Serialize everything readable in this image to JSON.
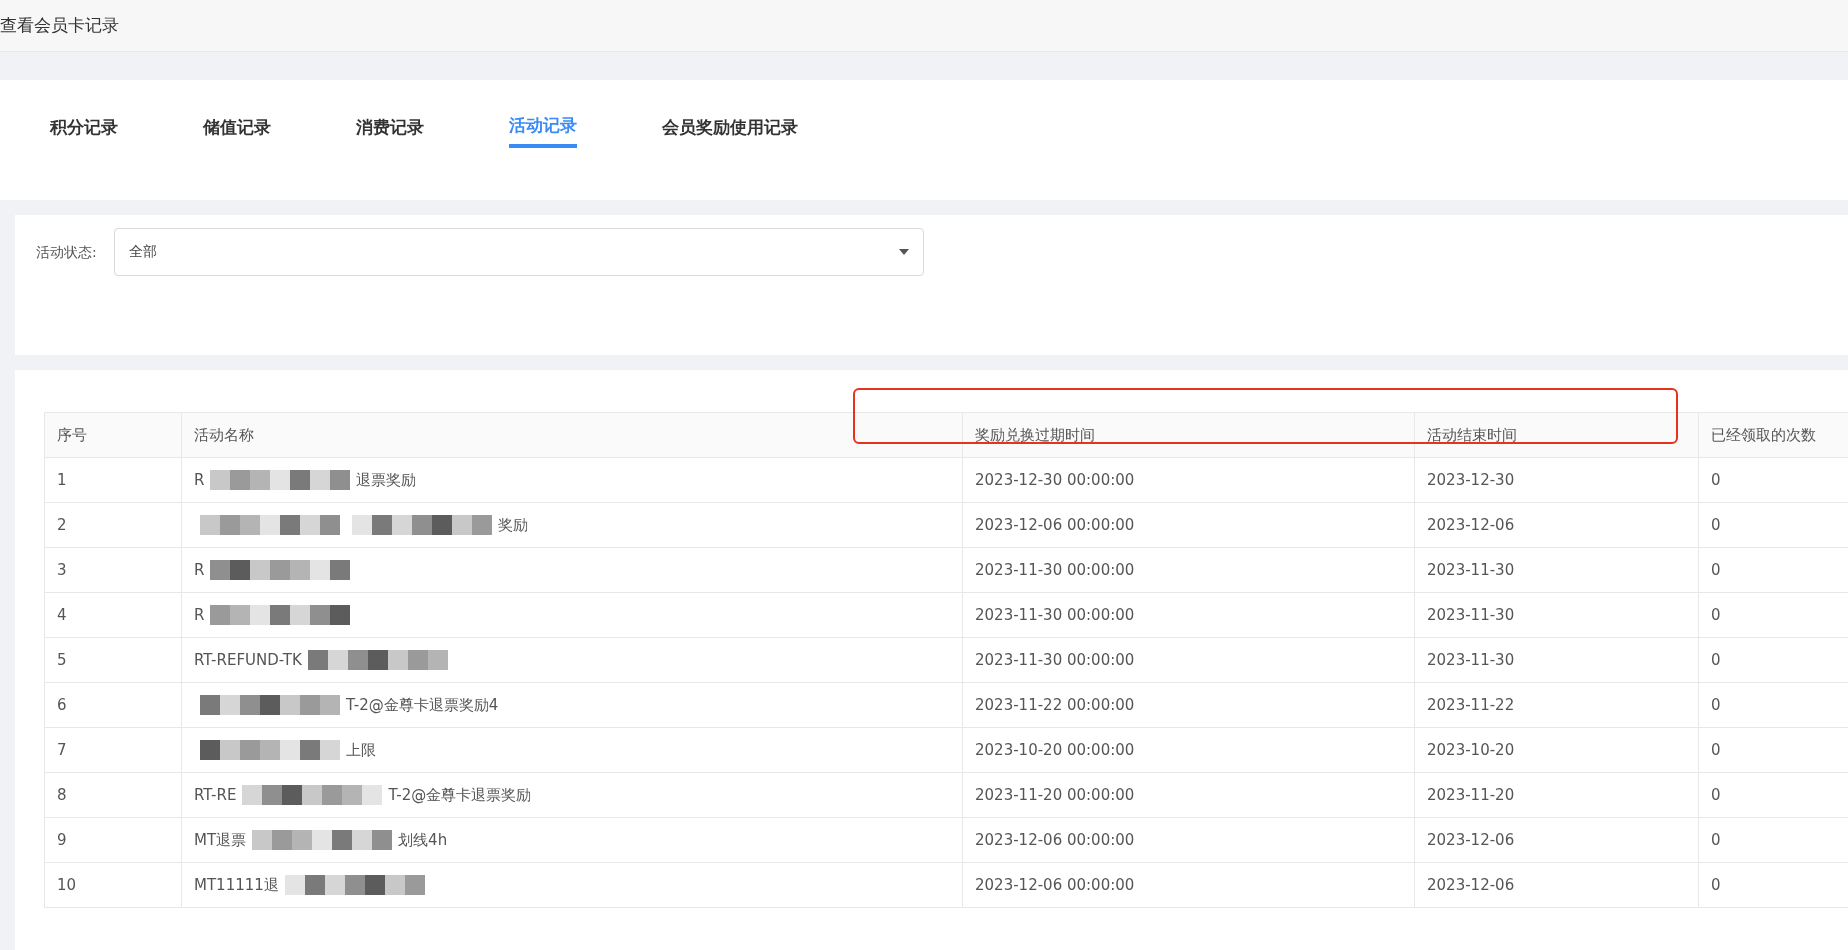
{
  "window": {
    "title": "查看会员卡记录"
  },
  "tabs": [
    {
      "label": "积分记录",
      "selected": false
    },
    {
      "label": "储值记录",
      "selected": false
    },
    {
      "label": "消费记录",
      "selected": false
    },
    {
      "label": "活动记录",
      "selected": true
    },
    {
      "label": "会员奖励使用记录",
      "selected": false
    }
  ],
  "filter": {
    "label": "活动状态:",
    "value": "全部"
  },
  "table": {
    "columns": [
      "序号",
      "活动名称",
      "奖励兑换过期时间",
      "活动结束时间",
      "已经领取的次数"
    ],
    "rows": [
      {
        "index": "1",
        "name": [
          {
            "kind": "text",
            "text": "R"
          },
          {
            "kind": "redacted"
          },
          {
            "kind": "text",
            "text": "退票奖励"
          }
        ],
        "expire": "2023-12-30 00:00:00",
        "end": "2023-12-30",
        "count": "0"
      },
      {
        "index": "2",
        "name": [
          {
            "kind": "redacted"
          },
          {
            "kind": "redacted"
          },
          {
            "kind": "text",
            "text": "奖励"
          }
        ],
        "expire": "2023-12-06 00:00:00",
        "end": "2023-12-06",
        "count": "0"
      },
      {
        "index": "3",
        "name": [
          {
            "kind": "text",
            "text": "R"
          },
          {
            "kind": "redacted"
          }
        ],
        "expire": "2023-11-30 00:00:00",
        "end": "2023-11-30",
        "count": "0"
      },
      {
        "index": "4",
        "name": [
          {
            "kind": "text",
            "text": "R"
          },
          {
            "kind": "redacted"
          }
        ],
        "expire": "2023-11-30 00:00:00",
        "end": "2023-11-30",
        "count": "0"
      },
      {
        "index": "5",
        "name": [
          {
            "kind": "text",
            "text": "RT-REFUND-TK"
          },
          {
            "kind": "redacted"
          }
        ],
        "expire": "2023-11-30 00:00:00",
        "end": "2023-11-30",
        "count": "0"
      },
      {
        "index": "6",
        "name": [
          {
            "kind": "redacted"
          },
          {
            "kind": "text",
            "text": "T-2@金尊卡退票奖励4"
          }
        ],
        "expire": "2023-11-22 00:00:00",
        "end": "2023-11-22",
        "count": "0"
      },
      {
        "index": "7",
        "name": [
          {
            "kind": "redacted"
          },
          {
            "kind": "text",
            "text": "上限"
          }
        ],
        "expire": "2023-10-20 00:00:00",
        "end": "2023-10-20",
        "count": "0"
      },
      {
        "index": "8",
        "name": [
          {
            "kind": "text",
            "text": "RT-RE"
          },
          {
            "kind": "redacted"
          },
          {
            "kind": "text",
            "text": "T-2@金尊卡退票奖励"
          }
        ],
        "expire": "2023-11-20 00:00:00",
        "end": "2023-11-20",
        "count": "0"
      },
      {
        "index": "9",
        "name": [
          {
            "kind": "text",
            "text": "MT退票"
          },
          {
            "kind": "redacted"
          },
          {
            "kind": "text",
            "text": "划线4h"
          }
        ],
        "expire": "2023-12-06 00:00:00",
        "end": "2023-12-06",
        "count": "0"
      },
      {
        "index": "10",
        "name": [
          {
            "kind": "text",
            "text": "MT11111退"
          },
          {
            "kind": "redacted"
          }
        ],
        "expire": "2023-12-06 00:00:00",
        "end": "2023-12-06",
        "count": "0"
      }
    ]
  }
}
